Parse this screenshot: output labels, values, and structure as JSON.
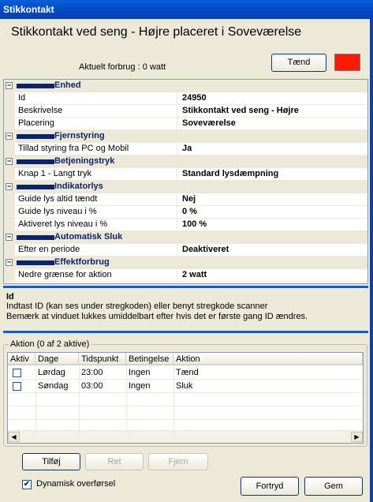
{
  "window": {
    "title": "Stikkontakt"
  },
  "heading": "Stikkontakt ved seng - Højre placeret i Soveværelse",
  "usage": "Aktuelt forbrug : 0 watt",
  "toggle_button": "Tænd",
  "colors": {
    "indicator": "#ff1a00",
    "category_bar": "#0a246a",
    "title_blue": "#0a5fd8"
  },
  "grid": {
    "rows": [
      {
        "type": "cat",
        "label": "Enhed"
      },
      {
        "type": "prop",
        "key": "Id",
        "value": "24950"
      },
      {
        "type": "prop",
        "key": "Beskrivelse",
        "value": "Stikkontakt ved seng - Højre"
      },
      {
        "type": "prop",
        "key": "Placering",
        "value": "Soveværelse"
      },
      {
        "type": "cat",
        "label": "Fjernstyring"
      },
      {
        "type": "prop",
        "key": "Tillad styring fra PC og Mobil",
        "value": "Ja"
      },
      {
        "type": "cat",
        "label": "Betjeningstryk"
      },
      {
        "type": "prop",
        "key": "Knap 1 - Langt tryk",
        "value": "Standard lysdæmpning"
      },
      {
        "type": "cat",
        "label": "Indikatorlys"
      },
      {
        "type": "prop",
        "key": "Guide lys altid tændt",
        "value": "Nej"
      },
      {
        "type": "prop",
        "key": "Guide lys niveau i %",
        "value": "0 %"
      },
      {
        "type": "prop",
        "key": "Aktiveret lys niveau i %",
        "value": "100 %"
      },
      {
        "type": "cat",
        "label": "Automatisk Sluk"
      },
      {
        "type": "prop",
        "key": "Efter en periode",
        "value": "Deaktiveret"
      },
      {
        "type": "cat",
        "label": "Effektforbrug"
      },
      {
        "type": "prop",
        "key": "Nedre grænse for aktion",
        "value": "2 watt"
      }
    ]
  },
  "description": {
    "title": "Id",
    "line1": "Indtast ID (kan ses under stregkoden) eller benyt stregkode scanner",
    "line2": "Bemærk at vinduet lukkes umiddelbart efter hvis det er første gang ID ændres."
  },
  "actions": {
    "group_label": "Aktion (0 af 2 aktive)",
    "columns": [
      "Aktiv",
      "Dage",
      "Tidspunkt",
      "Betingelse",
      "Aktion"
    ],
    "rows": [
      {
        "day": "Lørdag",
        "time": "23:00",
        "condition": "Ingen",
        "action": "Tænd",
        "active": false
      },
      {
        "day": "Søndag",
        "time": "03:00",
        "condition": "Ingen",
        "action": "Sluk",
        "active": false
      }
    ]
  },
  "buttons": {
    "add": "Tilføj",
    "edit": "Ret",
    "remove": "Fjern",
    "cancel": "Fortryd",
    "save": "Gem"
  },
  "dynamic_transfer": {
    "label": "Dynamisk overførsel",
    "checked": true
  }
}
